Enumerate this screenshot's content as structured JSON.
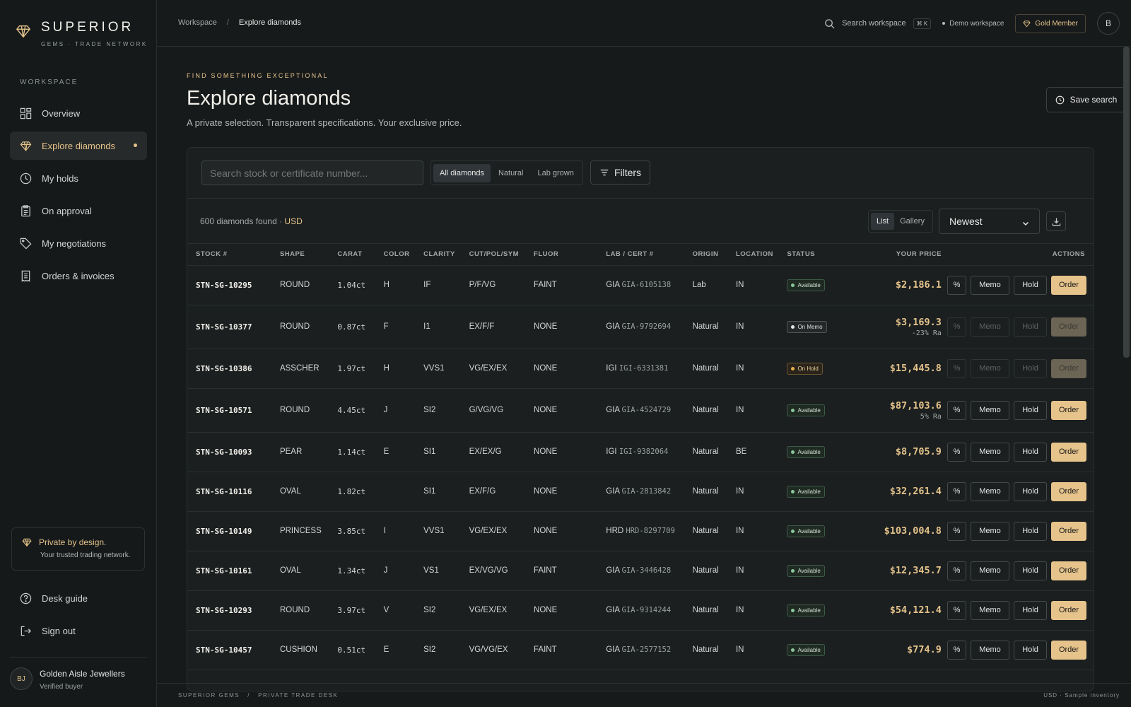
{
  "brand": {
    "name": "SUPERIOR",
    "tagline": "GEMS · TRADE NETWORK"
  },
  "sidebar": {
    "section_label": "WORKSPACE",
    "items": [
      {
        "label": "Overview",
        "icon": "grid-icon"
      },
      {
        "label": "Explore diamonds",
        "icon": "diamond-icon",
        "active": true
      },
      {
        "label": "My holds",
        "icon": "clock-icon"
      },
      {
        "label": "On approval",
        "icon": "clipboard-icon"
      },
      {
        "label": "My negotiations",
        "icon": "tag-icon"
      },
      {
        "label": "Orders & invoices",
        "icon": "receipt-icon"
      }
    ],
    "privacy_title": "Private by design.",
    "privacy_sub": "Your trusted trading network.",
    "bottom_items": [
      {
        "label": "Desk guide",
        "icon": "help-icon"
      },
      {
        "label": "Sign out",
        "icon": "logout-icon"
      }
    ],
    "user": {
      "initials": "BJ",
      "name": "Golden Aisle Jewellers",
      "role": "Verified buyer"
    }
  },
  "topbar": {
    "breadcrumb": [
      "Workspace",
      "/",
      "Explore diamonds"
    ],
    "search_label": "Search workspace",
    "shortcut": "⌘ K",
    "workspace": "Demo workspace",
    "membership": "Gold Member",
    "avatar": "B"
  },
  "page": {
    "eyebrow": "FIND SOMETHING EXCEPTIONAL",
    "title": "Explore diamonds",
    "subtitle": "A private selection. Transparent specifications. Your exclusive price.",
    "save_search": "Save search"
  },
  "toolbar": {
    "search_placeholder": "Search stock or certificate number...",
    "segments": [
      "All diamonds",
      "Natural",
      "Lab grown"
    ],
    "filters": "Filters"
  },
  "results": {
    "count_text": "600 diamonds found · ",
    "currency": "USD",
    "views": [
      "List",
      "Gallery"
    ],
    "sort": "Newest"
  },
  "table": {
    "headers": [
      "STOCK #",
      "SHAPE",
      "CARAT",
      "COLOR",
      "CLARITY",
      "CUT/POL/SYM",
      "FLUOR",
      "LAB / CERT #",
      "ORIGIN",
      "LOCATION",
      "STATUS",
      "YOUR PRICE",
      "ACTIONS"
    ],
    "actions": {
      "pct": "%",
      "memo": "Memo",
      "hold": "Hold",
      "order": "Order"
    },
    "rows": [
      {
        "stock": "STN-SG-10295",
        "shape": "ROUND",
        "carat": "1.04ct",
        "color": "H",
        "clarity": "IF",
        "cps": "P/F/VG",
        "fluor": "FAINT",
        "lab": "GIA",
        "cert": "GIA-6105138",
        "origin": "Lab",
        "location": "IN",
        "status": "Available",
        "price": "$2,186.1",
        "note": "",
        "disabled": false
      },
      {
        "stock": "STN-SG-10377",
        "shape": "ROUND",
        "carat": "0.87ct",
        "color": "F",
        "clarity": "I1",
        "cps": "EX/F/F",
        "fluor": "NONE",
        "lab": "GIA",
        "cert": "GIA-9792694",
        "origin": "Natural",
        "location": "IN",
        "status": "On Memo",
        "price": "$3,169.3",
        "note": "-23% Ra",
        "disabled": true
      },
      {
        "stock": "STN-SG-10386",
        "shape": "ASSCHER",
        "carat": "1.97ct",
        "color": "H",
        "clarity": "VVS1",
        "cps": "VG/EX/EX",
        "fluor": "NONE",
        "lab": "IGI",
        "cert": "IGI-6331381",
        "origin": "Natural",
        "location": "IN",
        "status": "On Hold",
        "price": "$15,445.8",
        "note": "",
        "disabled": true
      },
      {
        "stock": "STN-SG-10571",
        "shape": "ROUND",
        "carat": "4.45ct",
        "color": "J",
        "clarity": "SI2",
        "cps": "G/VG/VG",
        "fluor": "NONE",
        "lab": "GIA",
        "cert": "GIA-4524729",
        "origin": "Natural",
        "location": "IN",
        "status": "Available",
        "price": "$87,103.6",
        "note": "5% Ra",
        "disabled": false
      },
      {
        "stock": "STN-SG-10093",
        "shape": "PEAR",
        "carat": "1.14ct",
        "color": "E",
        "clarity": "SI1",
        "cps": "EX/EX/G",
        "fluor": "NONE",
        "lab": "IGI",
        "cert": "IGI-9382064",
        "origin": "Natural",
        "location": "BE",
        "status": "Available",
        "price": "$8,705.9",
        "note": "",
        "disabled": false
      },
      {
        "stock": "STN-SG-10116",
        "shape": "OVAL",
        "carat": "1.82ct",
        "color": "",
        "clarity": "SI1",
        "cps": "EX/F/G",
        "fluor": "NONE",
        "lab": "GIA",
        "cert": "GIA-2813842",
        "origin": "Natural",
        "location": "IN",
        "status": "Available",
        "price": "$32,261.4",
        "note": "",
        "disabled": false
      },
      {
        "stock": "STN-SG-10149",
        "shape": "PRINCESS",
        "carat": "3.85ct",
        "color": "I",
        "clarity": "VVS1",
        "cps": "VG/EX/EX",
        "fluor": "NONE",
        "lab": "HRD",
        "cert": "HRD-8297709",
        "origin": "Natural",
        "location": "IN",
        "status": "Available",
        "price": "$103,004.8",
        "note": "",
        "disabled": false
      },
      {
        "stock": "STN-SG-10161",
        "shape": "OVAL",
        "carat": "1.34ct",
        "color": "J",
        "clarity": "VS1",
        "cps": "EX/VG/VG",
        "fluor": "FAINT",
        "lab": "GIA",
        "cert": "GIA-3446428",
        "origin": "Natural",
        "location": "IN",
        "status": "Available",
        "price": "$12,345.7",
        "note": "",
        "disabled": false
      },
      {
        "stock": "STN-SG-10293",
        "shape": "ROUND",
        "carat": "3.97ct",
        "color": "V",
        "clarity": "SI2",
        "cps": "VG/EX/EX",
        "fluor": "NONE",
        "lab": "GIA",
        "cert": "GIA-9314244",
        "origin": "Natural",
        "location": "IN",
        "status": "Available",
        "price": "$54,121.4",
        "note": "",
        "disabled": false
      },
      {
        "stock": "STN-SG-10457",
        "shape": "CUSHION",
        "carat": "0.51ct",
        "color": "E",
        "clarity": "SI2",
        "cps": "VG/VG/EX",
        "fluor": "FAINT",
        "lab": "GIA",
        "cert": "GIA-2577152",
        "origin": "Natural",
        "location": "IN",
        "status": "Available",
        "price": "$774.9",
        "note": "",
        "disabled": false
      }
    ]
  },
  "footer": {
    "left": "SUPERIOR GEMS   /   PRIVATE TRADE DESK",
    "right": "USD · Sample inventory"
  },
  "colors": {
    "accent": "#e5c38b",
    "bg": "#171a1b",
    "available": "#8bc79a",
    "hold": "#e5b04a"
  }
}
